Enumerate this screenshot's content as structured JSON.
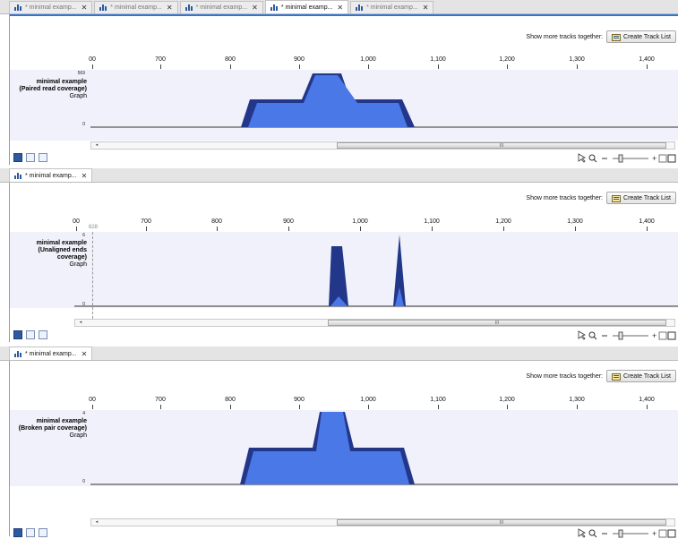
{
  "window_tabs": [
    {
      "label": "* minimal examp...",
      "active": false
    },
    {
      "label": "* minimal examp...",
      "active": false
    },
    {
      "label": "* minimal examp...",
      "active": false
    },
    {
      "label": "* minimal examp...",
      "active": true
    },
    {
      "label": "* minimal examp...",
      "active": false
    }
  ],
  "close_glyph": "✕",
  "scroll_grip": "III",
  "views": [
    {
      "tab_label": "* minimal examp...",
      "show_more_label": "Show more tracks together:",
      "create_button_label": "Create Track List",
      "ruler_ticks": [
        "00",
        "700",
        "800",
        "900",
        "1,000",
        "1,100",
        "1,200",
        "1,300",
        "1,400"
      ],
      "track": {
        "name_line1": "minimal example",
        "name_line2": "(Paired read coverage)",
        "name_line3": "",
        "type": "Graph",
        "y_max": "569",
        "y_min": "0"
      }
    },
    {
      "tab_label": "* minimal examp...",
      "show_more_label": "Show more tracks together:",
      "create_button_label": "Create Track List",
      "ruler_ticks": [
        "00",
        "700",
        "800",
        "900",
        "1,000",
        "1,100",
        "1,200",
        "1,300",
        "1,400"
      ],
      "cursor_position": "628",
      "track": {
        "name_line1": "minimal example",
        "name_line2": "(Unaligned ends",
        "name_line3": "coverage)",
        "type": "Graph",
        "y_max": "6",
        "y_min": "0"
      }
    },
    {
      "tab_label": "* minimal examp...",
      "show_more_label": "Show more tracks together:",
      "create_button_label": "Create Track List",
      "ruler_ticks": [
        "00",
        "700",
        "800",
        "900",
        "1,000",
        "1,100",
        "1,200",
        "1,300",
        "1,400"
      ],
      "track": {
        "name_line1": "minimal example",
        "name_line2": "(Broken pair coverage)",
        "name_line3": "",
        "type": "Graph",
        "y_max": "4",
        "y_min": "0"
      }
    }
  ],
  "colors": {
    "coverage_fill": "#4a78e6",
    "coverage_dark": "#23378a",
    "track_background": "#f0f1fa",
    "accent_blue": "#3574d6"
  }
}
